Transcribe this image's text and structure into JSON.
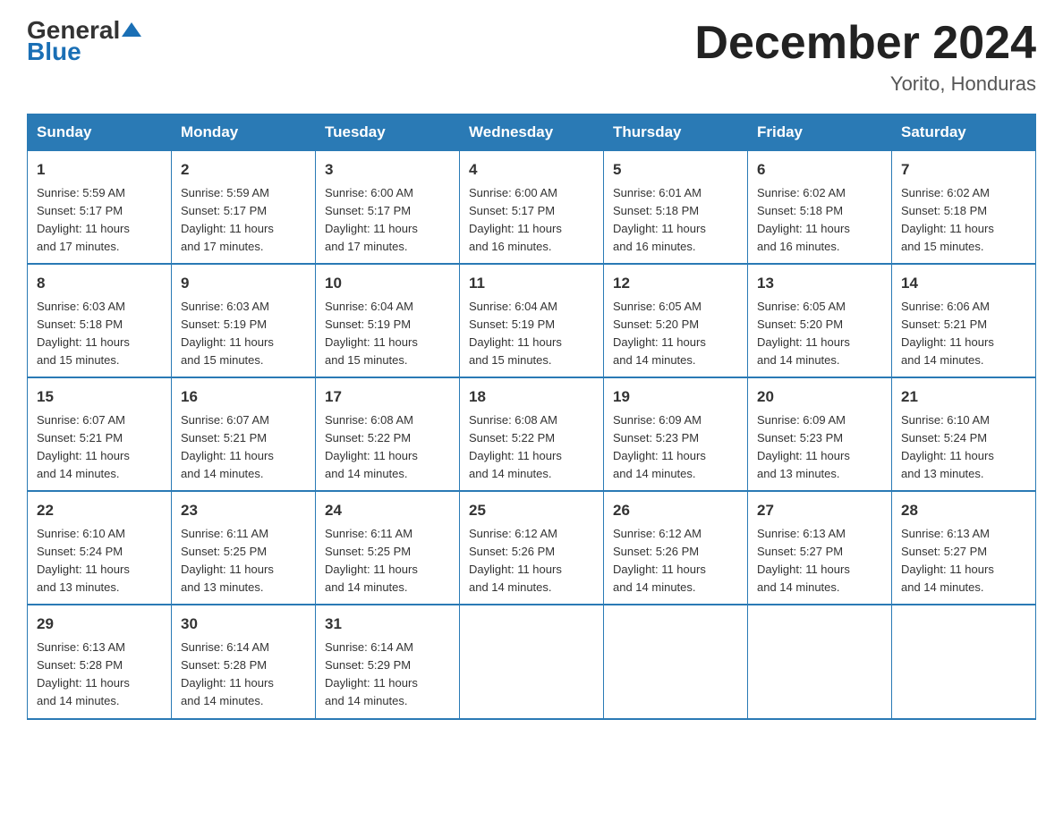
{
  "header": {
    "logo_general": "General",
    "logo_blue": "Blue",
    "month_title": "December 2024",
    "location": "Yorito, Honduras"
  },
  "days_of_week": [
    "Sunday",
    "Monday",
    "Tuesday",
    "Wednesday",
    "Thursday",
    "Friday",
    "Saturday"
  ],
  "weeks": [
    [
      {
        "day": "1",
        "info": "Sunrise: 5:59 AM\nSunset: 5:17 PM\nDaylight: 11 hours\nand 17 minutes."
      },
      {
        "day": "2",
        "info": "Sunrise: 5:59 AM\nSunset: 5:17 PM\nDaylight: 11 hours\nand 17 minutes."
      },
      {
        "day": "3",
        "info": "Sunrise: 6:00 AM\nSunset: 5:17 PM\nDaylight: 11 hours\nand 17 minutes."
      },
      {
        "day": "4",
        "info": "Sunrise: 6:00 AM\nSunset: 5:17 PM\nDaylight: 11 hours\nand 16 minutes."
      },
      {
        "day": "5",
        "info": "Sunrise: 6:01 AM\nSunset: 5:18 PM\nDaylight: 11 hours\nand 16 minutes."
      },
      {
        "day": "6",
        "info": "Sunrise: 6:02 AM\nSunset: 5:18 PM\nDaylight: 11 hours\nand 16 minutes."
      },
      {
        "day": "7",
        "info": "Sunrise: 6:02 AM\nSunset: 5:18 PM\nDaylight: 11 hours\nand 15 minutes."
      }
    ],
    [
      {
        "day": "8",
        "info": "Sunrise: 6:03 AM\nSunset: 5:18 PM\nDaylight: 11 hours\nand 15 minutes."
      },
      {
        "day": "9",
        "info": "Sunrise: 6:03 AM\nSunset: 5:19 PM\nDaylight: 11 hours\nand 15 minutes."
      },
      {
        "day": "10",
        "info": "Sunrise: 6:04 AM\nSunset: 5:19 PM\nDaylight: 11 hours\nand 15 minutes."
      },
      {
        "day": "11",
        "info": "Sunrise: 6:04 AM\nSunset: 5:19 PM\nDaylight: 11 hours\nand 15 minutes."
      },
      {
        "day": "12",
        "info": "Sunrise: 6:05 AM\nSunset: 5:20 PM\nDaylight: 11 hours\nand 14 minutes."
      },
      {
        "day": "13",
        "info": "Sunrise: 6:05 AM\nSunset: 5:20 PM\nDaylight: 11 hours\nand 14 minutes."
      },
      {
        "day": "14",
        "info": "Sunrise: 6:06 AM\nSunset: 5:21 PM\nDaylight: 11 hours\nand 14 minutes."
      }
    ],
    [
      {
        "day": "15",
        "info": "Sunrise: 6:07 AM\nSunset: 5:21 PM\nDaylight: 11 hours\nand 14 minutes."
      },
      {
        "day": "16",
        "info": "Sunrise: 6:07 AM\nSunset: 5:21 PM\nDaylight: 11 hours\nand 14 minutes."
      },
      {
        "day": "17",
        "info": "Sunrise: 6:08 AM\nSunset: 5:22 PM\nDaylight: 11 hours\nand 14 minutes."
      },
      {
        "day": "18",
        "info": "Sunrise: 6:08 AM\nSunset: 5:22 PM\nDaylight: 11 hours\nand 14 minutes."
      },
      {
        "day": "19",
        "info": "Sunrise: 6:09 AM\nSunset: 5:23 PM\nDaylight: 11 hours\nand 14 minutes."
      },
      {
        "day": "20",
        "info": "Sunrise: 6:09 AM\nSunset: 5:23 PM\nDaylight: 11 hours\nand 13 minutes."
      },
      {
        "day": "21",
        "info": "Sunrise: 6:10 AM\nSunset: 5:24 PM\nDaylight: 11 hours\nand 13 minutes."
      }
    ],
    [
      {
        "day": "22",
        "info": "Sunrise: 6:10 AM\nSunset: 5:24 PM\nDaylight: 11 hours\nand 13 minutes."
      },
      {
        "day": "23",
        "info": "Sunrise: 6:11 AM\nSunset: 5:25 PM\nDaylight: 11 hours\nand 13 minutes."
      },
      {
        "day": "24",
        "info": "Sunrise: 6:11 AM\nSunset: 5:25 PM\nDaylight: 11 hours\nand 14 minutes."
      },
      {
        "day": "25",
        "info": "Sunrise: 6:12 AM\nSunset: 5:26 PM\nDaylight: 11 hours\nand 14 minutes."
      },
      {
        "day": "26",
        "info": "Sunrise: 6:12 AM\nSunset: 5:26 PM\nDaylight: 11 hours\nand 14 minutes."
      },
      {
        "day": "27",
        "info": "Sunrise: 6:13 AM\nSunset: 5:27 PM\nDaylight: 11 hours\nand 14 minutes."
      },
      {
        "day": "28",
        "info": "Sunrise: 6:13 AM\nSunset: 5:27 PM\nDaylight: 11 hours\nand 14 minutes."
      }
    ],
    [
      {
        "day": "29",
        "info": "Sunrise: 6:13 AM\nSunset: 5:28 PM\nDaylight: 11 hours\nand 14 minutes."
      },
      {
        "day": "30",
        "info": "Sunrise: 6:14 AM\nSunset: 5:28 PM\nDaylight: 11 hours\nand 14 minutes."
      },
      {
        "day": "31",
        "info": "Sunrise: 6:14 AM\nSunset: 5:29 PM\nDaylight: 11 hours\nand 14 minutes."
      },
      {
        "day": "",
        "info": ""
      },
      {
        "day": "",
        "info": ""
      },
      {
        "day": "",
        "info": ""
      },
      {
        "day": "",
        "info": ""
      }
    ]
  ]
}
